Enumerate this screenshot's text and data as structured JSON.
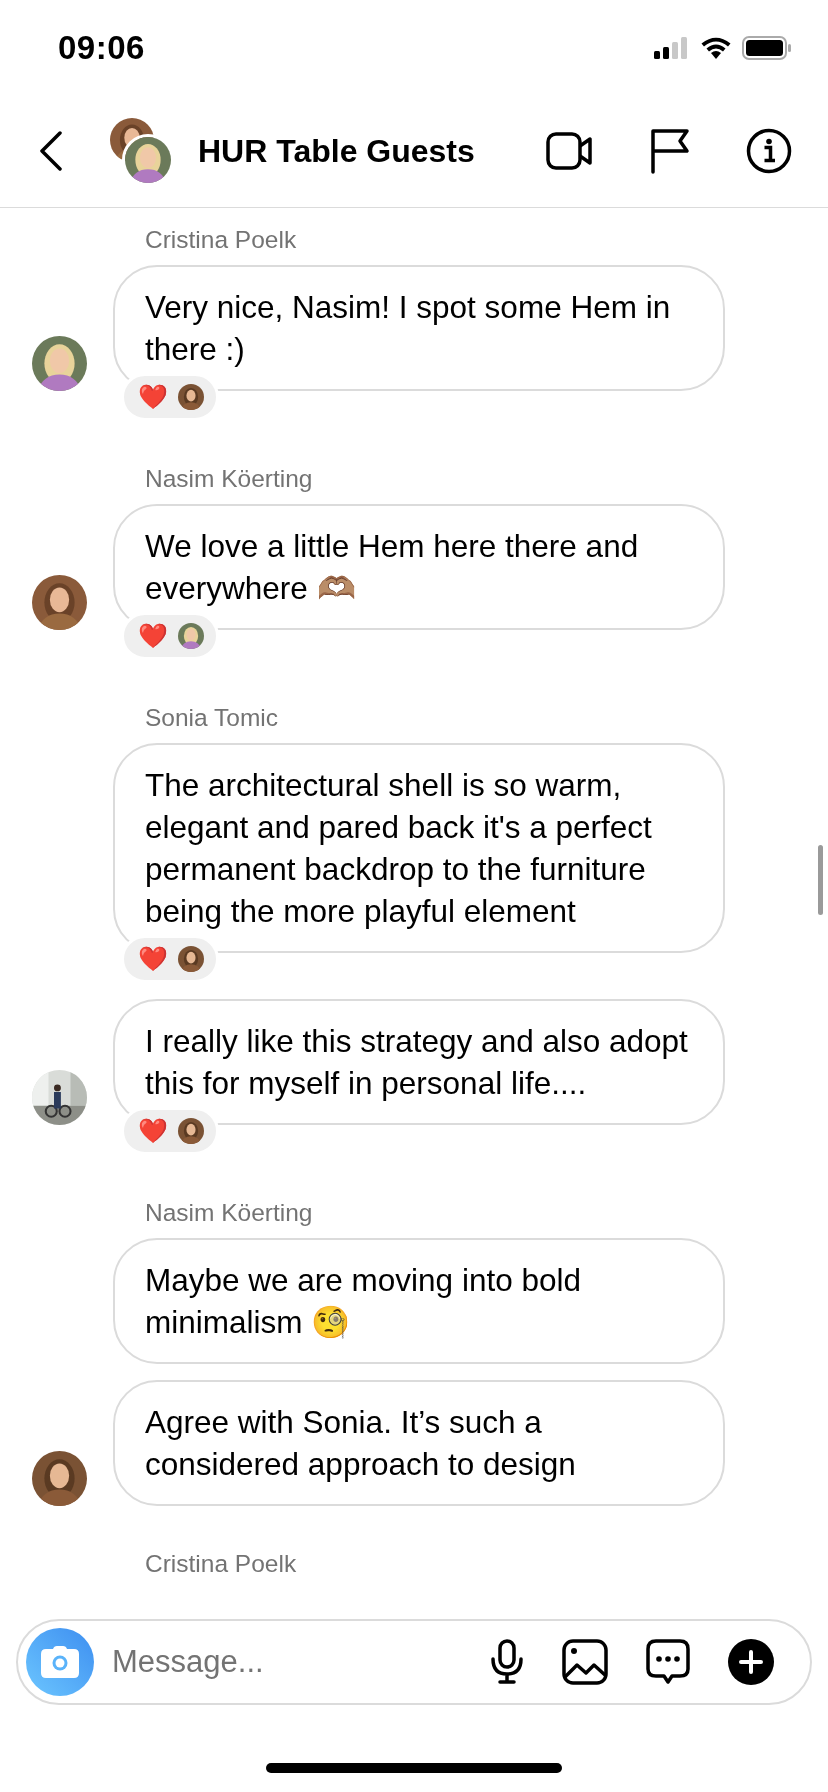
{
  "status_bar": {
    "time": "09:06"
  },
  "header": {
    "title": "HUR Table Guests"
  },
  "messages": [
    {
      "sender": "Cristina Poelk",
      "text": "Very nice, Nasim! I spot some Hem in there :)",
      "avatar": true,
      "reaction": "❤️"
    },
    {
      "sender": "Nasim Köerting",
      "text": "We love a little Hem here there and everywhere 🫶🏽",
      "avatar": true,
      "reaction": "❤️"
    },
    {
      "sender": "Sonia Tomic",
      "text": "The architectural shell is so warm, elegant and pared back it's a perfect permanent backdrop to the furniture being the more playful element",
      "avatar": false,
      "reaction": "❤️"
    },
    {
      "text": "I really like this strategy and also adopt this for myself in personal life....",
      "avatar": true,
      "reaction": "❤️"
    },
    {
      "sender": "Nasim Köerting",
      "text": "Maybe we are moving into bold minimalism 🧐",
      "avatar": false
    },
    {
      "text": "Agree with Sonia. It’s such a considered approach to design",
      "avatar": true
    },
    {
      "sender": "Cristina Poelk"
    }
  ],
  "composer": {
    "placeholder": "Message..."
  }
}
